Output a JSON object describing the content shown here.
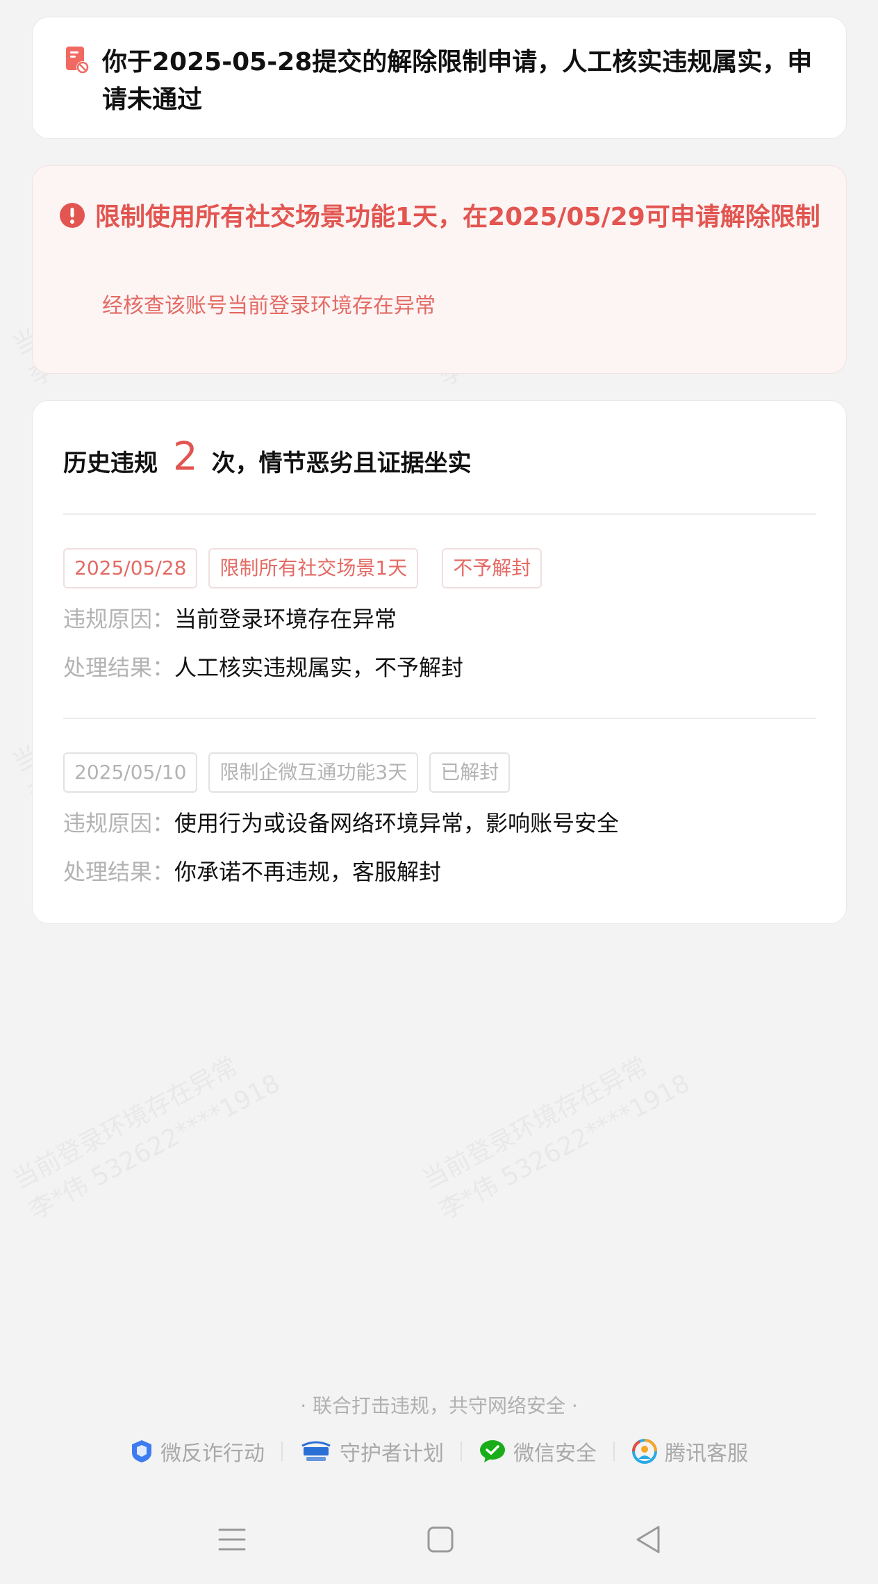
{
  "status": {
    "message": "你于2025-05-28提交的解除限制申请，人工核实违规属实，申请未通过",
    "icon": "document-blocked-icon"
  },
  "restriction": {
    "headline": "限制使用所有社交场景功能1天，在2025/05/29可申请解除限制",
    "reason": "经核查该账号当前登录环境存在异常",
    "icon": "exclamation-circle-icon",
    "color": "#e25550"
  },
  "history": {
    "title_prefix": "历史违规",
    "count": "2",
    "title_suffix": "次，情节恶劣且证据坐实",
    "reason_label": "违规原因：",
    "result_label": "处理结果：",
    "records": [
      {
        "date": "2025/05/28",
        "restriction": "限制所有社交场景1天",
        "status": "不予解封",
        "reason": "当前登录环境存在异常",
        "result": "人工核实违规属实，不予解封"
      },
      {
        "date": "2025/05/10",
        "restriction": "限制企微互通功能3天",
        "status": "已解封",
        "reason": "使用行为或设备网络环境异常，影响账号安全",
        "result": "你承诺不再违规，客服解封"
      }
    ]
  },
  "footer": {
    "slogan": "· 联合打击违规，共守网络安全 ·",
    "links": [
      {
        "label": "微反诈行动",
        "icon": "anti-fraud-icon"
      },
      {
        "label": "守护者计划",
        "icon": "guardian-plan-icon"
      },
      {
        "label": "微信安全",
        "icon": "wechat-security-icon"
      },
      {
        "label": "腾讯客服",
        "icon": "tencent-service-icon"
      }
    ]
  },
  "watermark": {
    "line1": "当前登录环境存在异常",
    "line2": "李*伟 532622****1918"
  },
  "navbar": {
    "icons": [
      "menu-icon",
      "home-icon",
      "back-icon"
    ]
  }
}
